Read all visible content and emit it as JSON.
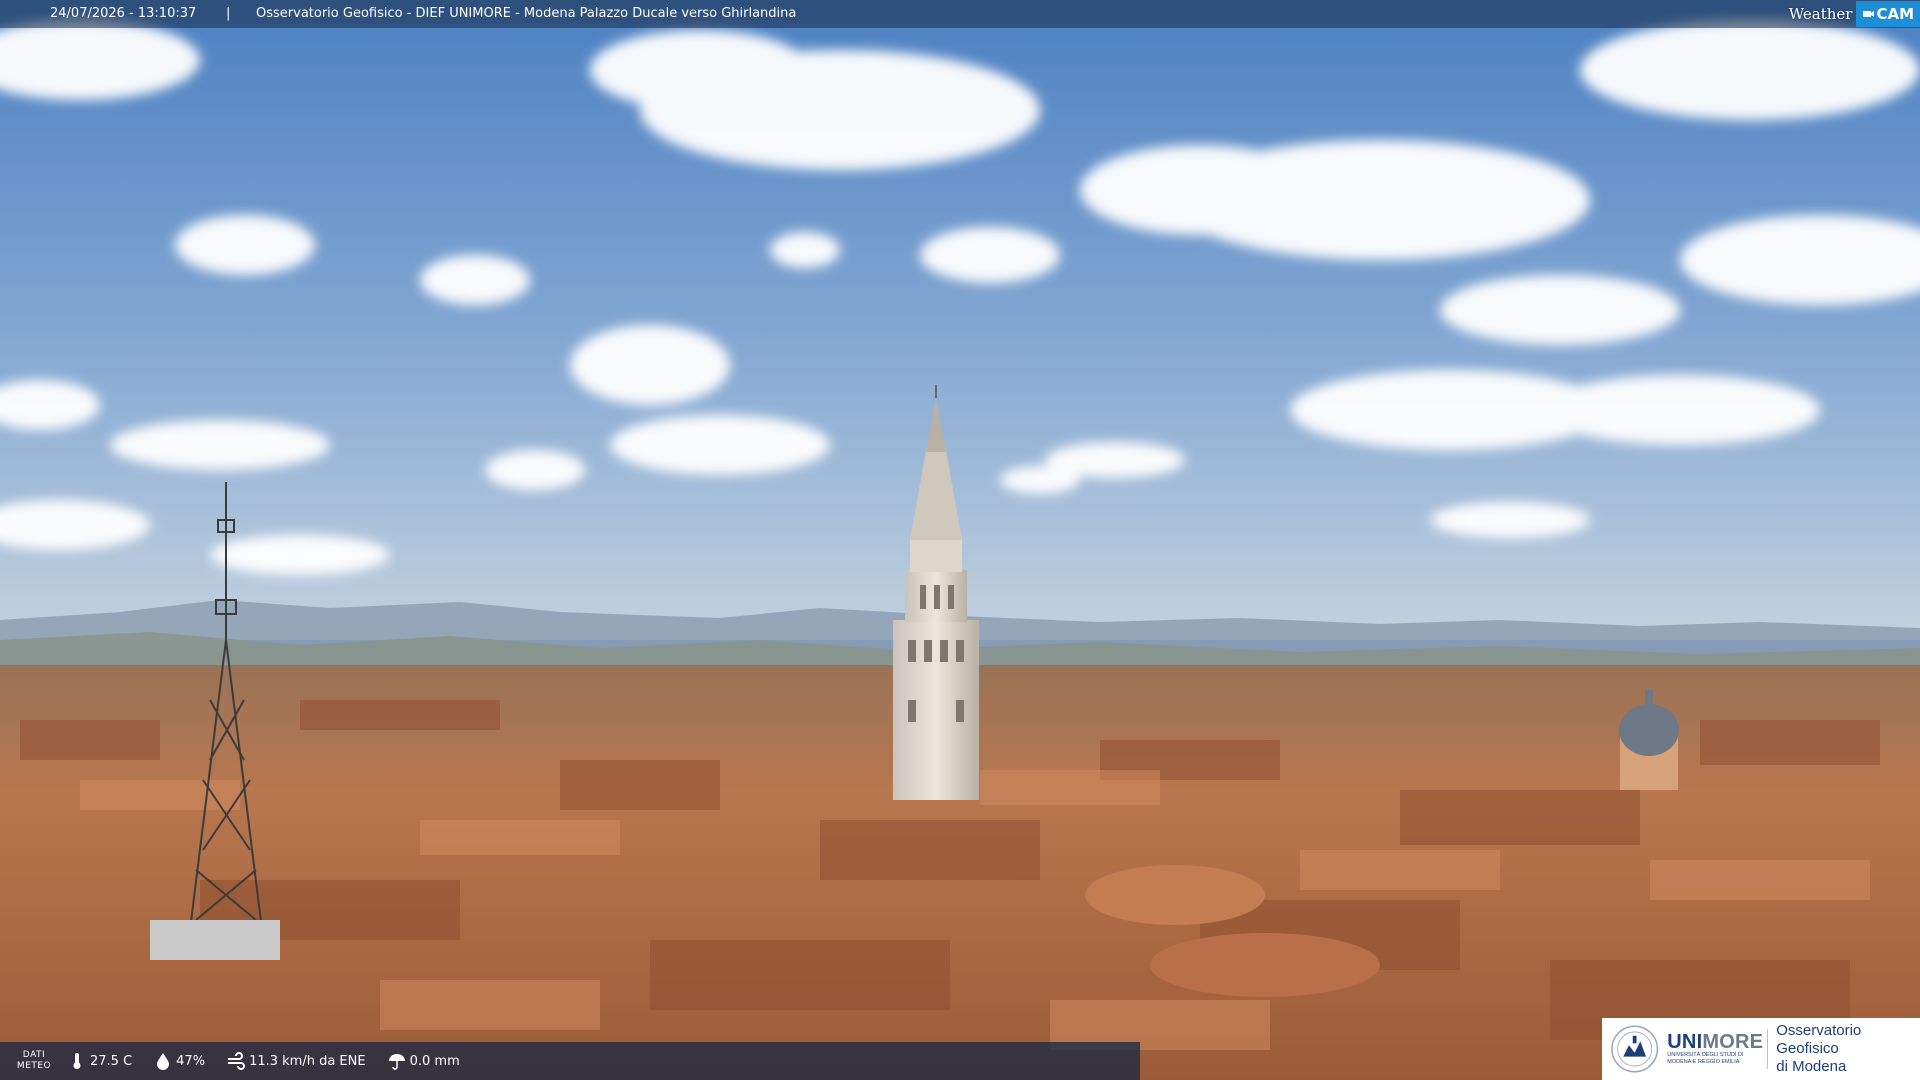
{
  "overlay": {
    "timestamp": "24/07/2026 - 13:10:37",
    "separator": "|",
    "title": "Osservatorio Geofisico - DIEF UNIMORE - Modena Palazzo Ducale verso Ghirlandina"
  },
  "brand": {
    "weather_text": "Weather",
    "cam_text": "CAM"
  },
  "weather": {
    "label_line1": "DATI",
    "label_line2": "METEO",
    "temperature": "27.5 C",
    "humidity": "47%",
    "wind": "11.3 km/h da ENE",
    "rain": "0.0 mm"
  },
  "logo": {
    "name_part1": "UNI",
    "name_part2": "MORE",
    "sub_line1": "Università degli studi di",
    "sub_line2": "Modena e Reggio Emilia",
    "obs_line1": "Osservatorio Geofisico",
    "obs_line2": "di Modena"
  },
  "colors": {
    "sky_top": "#4f83c4",
    "sky_horizon": "#b4c8da",
    "roof": "#b5714a",
    "bar_bg": "#1e2e48",
    "cam_blue": "#1e8fd6",
    "logo_blue": "#1c3f7a"
  }
}
